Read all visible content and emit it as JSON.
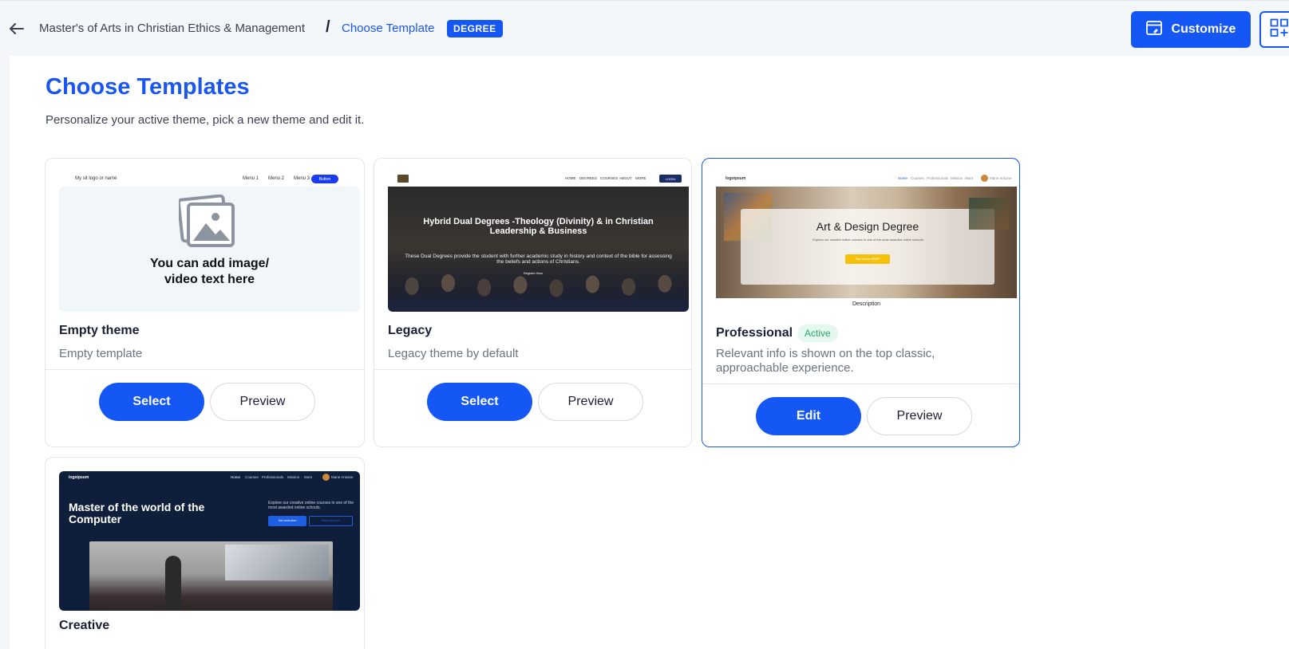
{
  "header": {
    "back_icon": "arrow-left-icon",
    "breadcrumb_parent": "Master's of Arts in Christian Ethics & Management",
    "breadcrumb_separator": "/",
    "breadcrumb_current": "Choose Template",
    "badge": "DEGREE",
    "customize_label": "Customize",
    "customize_icon": "browser-edit-icon",
    "grid_icon": "grid-add-icon"
  },
  "page": {
    "title": "Choose Templates",
    "subtitle": "Personalize your active theme, pick a new theme and edit it."
  },
  "templates": [
    {
      "name": "Empty theme",
      "description": "Empty template",
      "active": false,
      "primary_action": "Select",
      "secondary_action": "Preview",
      "preview": {
        "logo_text": "My sit logo or name",
        "menu": [
          "Menu 1",
          "Menu 2",
          "Menu 3"
        ],
        "cta": "Button",
        "placeholder_icon": "images-icon",
        "hero_text": "You can add image/ video text here"
      }
    },
    {
      "name": "Legacy",
      "description": "Legacy theme by default",
      "active": false,
      "primary_action": "Select",
      "secondary_action": "Preview",
      "preview": {
        "menu": [
          "HOME",
          "DEGREES",
          "COURSES",
          "ABOUT",
          "MORE"
        ],
        "cta": "LOGIN",
        "hero_title": "Hybrid Dual Degrees -Theology (Divinity) & in Christian Leadership & Business",
        "hero_sub": "These Dual Degrees provide the student with further academic study in history and context of the bible for assessing the beliefs and actions of Christians.",
        "hero_link": "Register Now"
      }
    },
    {
      "name": "Professional",
      "description": "Relevant info is shown on the top classic, approachable experience.",
      "active": true,
      "active_label": "Active",
      "primary_action": "Edit",
      "secondary_action": "Preview",
      "preview": {
        "logo_text": "logoipsum",
        "menu": [
          "Home",
          "Courses",
          "Professionals",
          "Mission",
          "More"
        ],
        "user": "Marie Antoine",
        "hero_title": "Art & Design Degree",
        "hero_sub": "Explore our creative online courses in one of the most awarded online schools.",
        "hero_cta": "Start Course BRIEF",
        "section_peek": "Description"
      }
    },
    {
      "name": "Creative",
      "description": "",
      "active": false,
      "preview": {
        "logo_text": "logoipsum",
        "menu": [
          "Home",
          "Courses",
          "Professionals",
          "Mission",
          "More"
        ],
        "user": "Marie Antoine",
        "hero_title": "Master of the world of the Computer",
        "hero_sub": "Explore our creative online courses in one of the most awarded online schools.",
        "cta_primary": "Get curriculum",
        "cta_secondary": "Meet instructor"
      }
    }
  ],
  "colors": {
    "accent": "#1557f5",
    "active_badge_bg": "#e4f8ef",
    "active_badge_text": "#2fa36b",
    "background": "#f4f7f9"
  }
}
